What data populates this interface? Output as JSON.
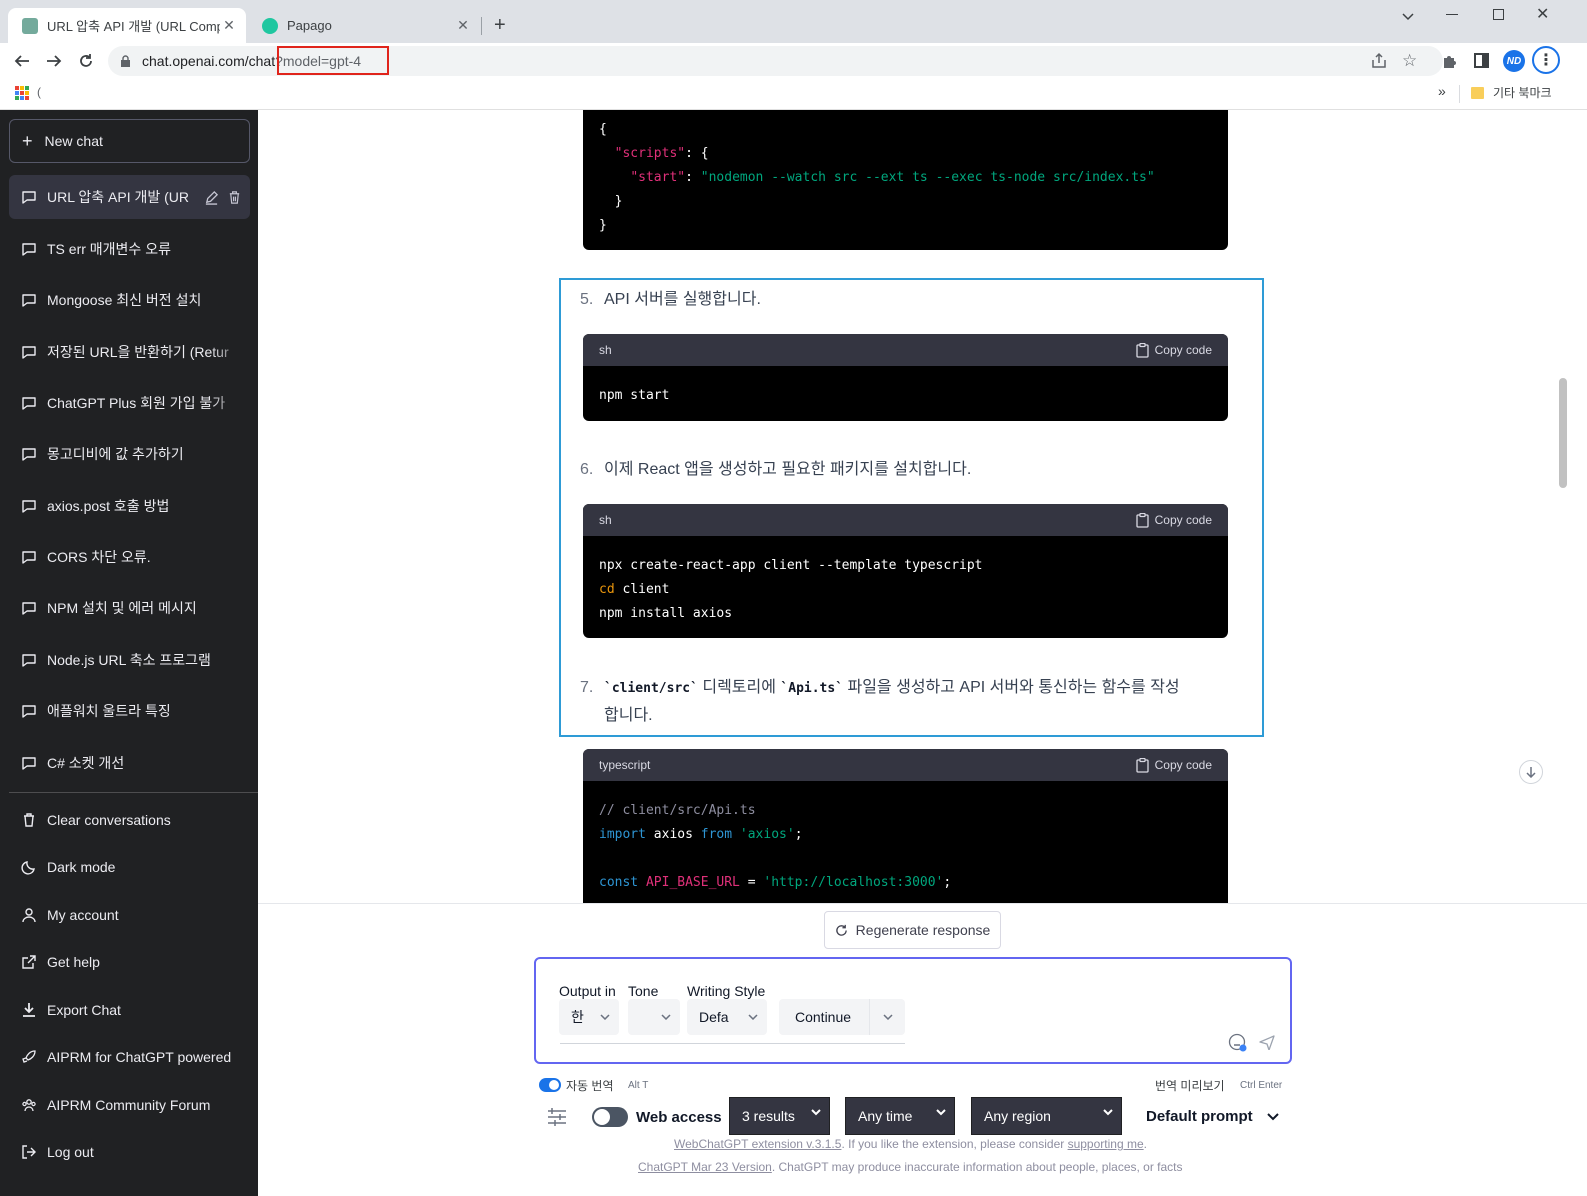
{
  "browser": {
    "tabs": [
      {
        "title": "URL 압축 API 개발 (URL Compre",
        "active": true
      },
      {
        "title": "Papago",
        "active": false
      }
    ],
    "url_host": "chat.openai.com/chat",
    "url_rest": "?model=gpt-4",
    "bookmarks_folder": "기타 북마크",
    "bookmark_partial": "(",
    "profile_initials": "ND",
    "more_bookmarks": "»"
  },
  "sidebar": {
    "new_chat": "New chat",
    "conversations": [
      "URL 압축 API 개발 (UR",
      "TS err 매개변수 오류",
      "Mongoose 최신 버전 설치",
      "저장된 URL을 반환하기 (Retur",
      "ChatGPT Plus 회원 가입 불가",
      "몽고디비에 값 추가하기",
      "axios.post 호출 방법",
      "CORS 차단 오류.",
      "NPM 설치 및 에러 메시지",
      "Node.js URL 축소 프로그램",
      "애플워치 울트라 특징",
      "C# 소켓 개선"
    ],
    "footer": [
      {
        "label": "Clear conversations",
        "icon": "trash-icon"
      },
      {
        "label": "Dark mode",
        "icon": "moon-icon"
      },
      {
        "label": "My account",
        "icon": "user-icon"
      },
      {
        "label": "Get help",
        "icon": "external-link-icon"
      },
      {
        "label": "Export Chat",
        "icon": "download-icon"
      },
      {
        "label": "AIPRM for ChatGPT powered",
        "icon": "rocket-icon"
      },
      {
        "label": "AIPRM Community Forum",
        "icon": "community-icon"
      },
      {
        "label": "Log out",
        "icon": "logout-icon"
      }
    ]
  },
  "content": {
    "json_block": {
      "l1": "{",
      "l2_key": "\"scripts\"",
      "l2_rest": ": {",
      "l3_key": "\"start\"",
      "l3_colon": ": ",
      "l3_val": "\"nodemon --watch src --ext ts --exec ts-node src/index.ts\"",
      "l4": "  }",
      "l5": "}"
    },
    "step5": {
      "num": "5.",
      "text": "API 서버를 실행합니다."
    },
    "code5": {
      "lang": "sh",
      "copy": "Copy code",
      "line1": "npm start"
    },
    "step6": {
      "num": "6.",
      "text": "이제 React 앱을 생성하고 필요한 패키지를 설치합니다."
    },
    "code6": {
      "lang": "sh",
      "copy": "Copy code",
      "line1": "npx create-react-app client --template typescript",
      "cd": "cd",
      "cd_arg": " client",
      "line3": "npm install axios"
    },
    "step7": {
      "num": "7.",
      "code1": "`client/src`",
      "t1": " 디렉토리에 ",
      "code2": "`Api.ts`",
      "t2": " 파일을 생성하고 API 서버와 통신하는 함수를 작성",
      "t3": "합니다."
    },
    "code7": {
      "lang": "typescript",
      "copy": "Copy code",
      "comment": "// client/src/Api.ts",
      "import_kw": "import",
      "import_name": " axios ",
      "from_kw": "from",
      "import_src": " 'axios'",
      "semi": ";",
      "const_kw": "const",
      "const_name": " API_BASE_URL",
      "eq": " = ",
      "const_val": "'http://localhost:3000'",
      "semi2": ";"
    }
  },
  "bottom": {
    "regenerate": "Regenerate response",
    "output_label": "Output in",
    "tone_label": "Tone",
    "style_label": "Writing Style",
    "output_value": "한",
    "tone_value": "",
    "style_value": "Defa",
    "continue": "Continue",
    "auto_translate": "자동 번역",
    "auto_shortcut": "Alt T",
    "preview": "번역 미리보기",
    "preview_shortcut": "Ctrl Enter",
    "web_access": "Web access",
    "results": "3 results",
    "time": "Any time",
    "region": "Any region",
    "default_prompt": "Default prompt",
    "ext_link": "WebChatGPT extension v.3.1.5",
    "ext_text": ". If you like the extension, please consider ",
    "ext_support": "supporting me",
    "ext_end": ".",
    "version_link": "ChatGPT Mar 23 Version",
    "version_text": ". ChatGPT may produce inaccurate information about people, places, or facts"
  },
  "colors": {
    "sidebar_bg": "#202123",
    "selection_box": "#2e9bd6",
    "url_highlight": "#e0241b",
    "prompt_border": "#6366f1"
  }
}
